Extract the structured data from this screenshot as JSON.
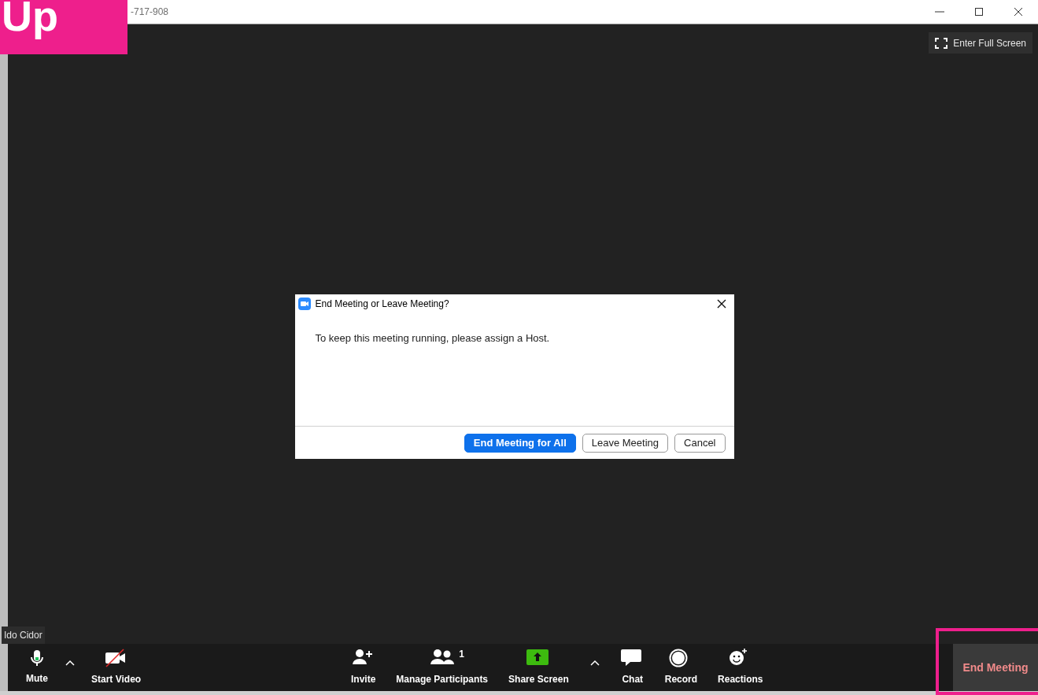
{
  "window": {
    "title": "-717-908"
  },
  "annotation": {
    "text": "Up"
  },
  "full_screen_button": {
    "label": "Enter Full Screen"
  },
  "dialog": {
    "title": "End Meeting or Leave Meeting?",
    "message": "To keep this meeting running, please assign a Host.",
    "buttons": [
      {
        "label": "End Meeting for All",
        "primary": true
      },
      {
        "label": "Leave Meeting",
        "primary": false
      },
      {
        "label": "Cancel",
        "primary": false
      }
    ]
  },
  "name_tag": "Ido Cidor",
  "toolbar": {
    "left": [
      {
        "kind": "button",
        "label": "Mute"
      },
      {
        "kind": "caret"
      },
      {
        "kind": "button",
        "label": "Start Video",
        "off": true
      }
    ],
    "center": [
      {
        "kind": "button",
        "label": "Invite"
      },
      {
        "kind": "button",
        "label": "Manage Participants",
        "badge": "1"
      },
      {
        "kind": "button",
        "label": "Share Screen"
      },
      {
        "kind": "caret"
      },
      {
        "kind": "button",
        "label": "Chat"
      },
      {
        "kind": "button",
        "label": "Record"
      },
      {
        "kind": "button",
        "label": "Reactions"
      }
    ],
    "end_button": {
      "label": "End Meeting",
      "highlighted": true
    }
  }
}
